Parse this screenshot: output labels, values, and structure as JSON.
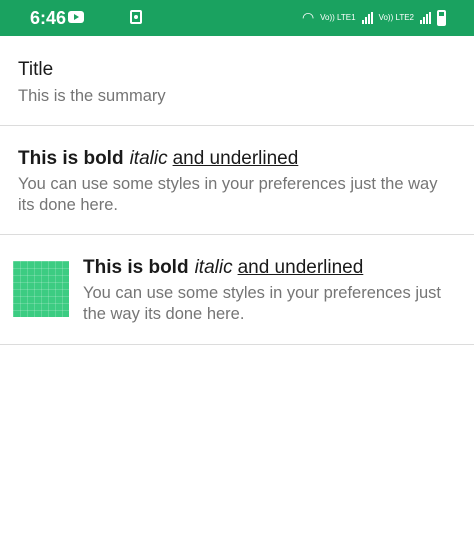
{
  "status_bar": {
    "time": "6:46",
    "icons": [
      "youtube-icon",
      "app-notification-icon",
      "wifi-icon",
      "signal-lte1-icon",
      "signal-lte2-icon",
      "battery-icon"
    ],
    "lte1_label": "Vo)) LTE1",
    "lte2_label": "Vo)) LTE2",
    "background_color": "#1aa260"
  },
  "preferences": [
    {
      "title": "Title",
      "summary": "This is the summary"
    },
    {
      "title_bold": "This is bold",
      "title_italic": "italic",
      "title_underlined": "and underlined",
      "summary": "You can use some styles in your preferences just the way its done here."
    },
    {
      "icon": "green-grid-thumbnail",
      "title_bold": "This is bold",
      "title_italic": "italic",
      "title_underlined": "and underlined",
      "summary": "You can use some styles in your preferences just the way its done here."
    }
  ]
}
